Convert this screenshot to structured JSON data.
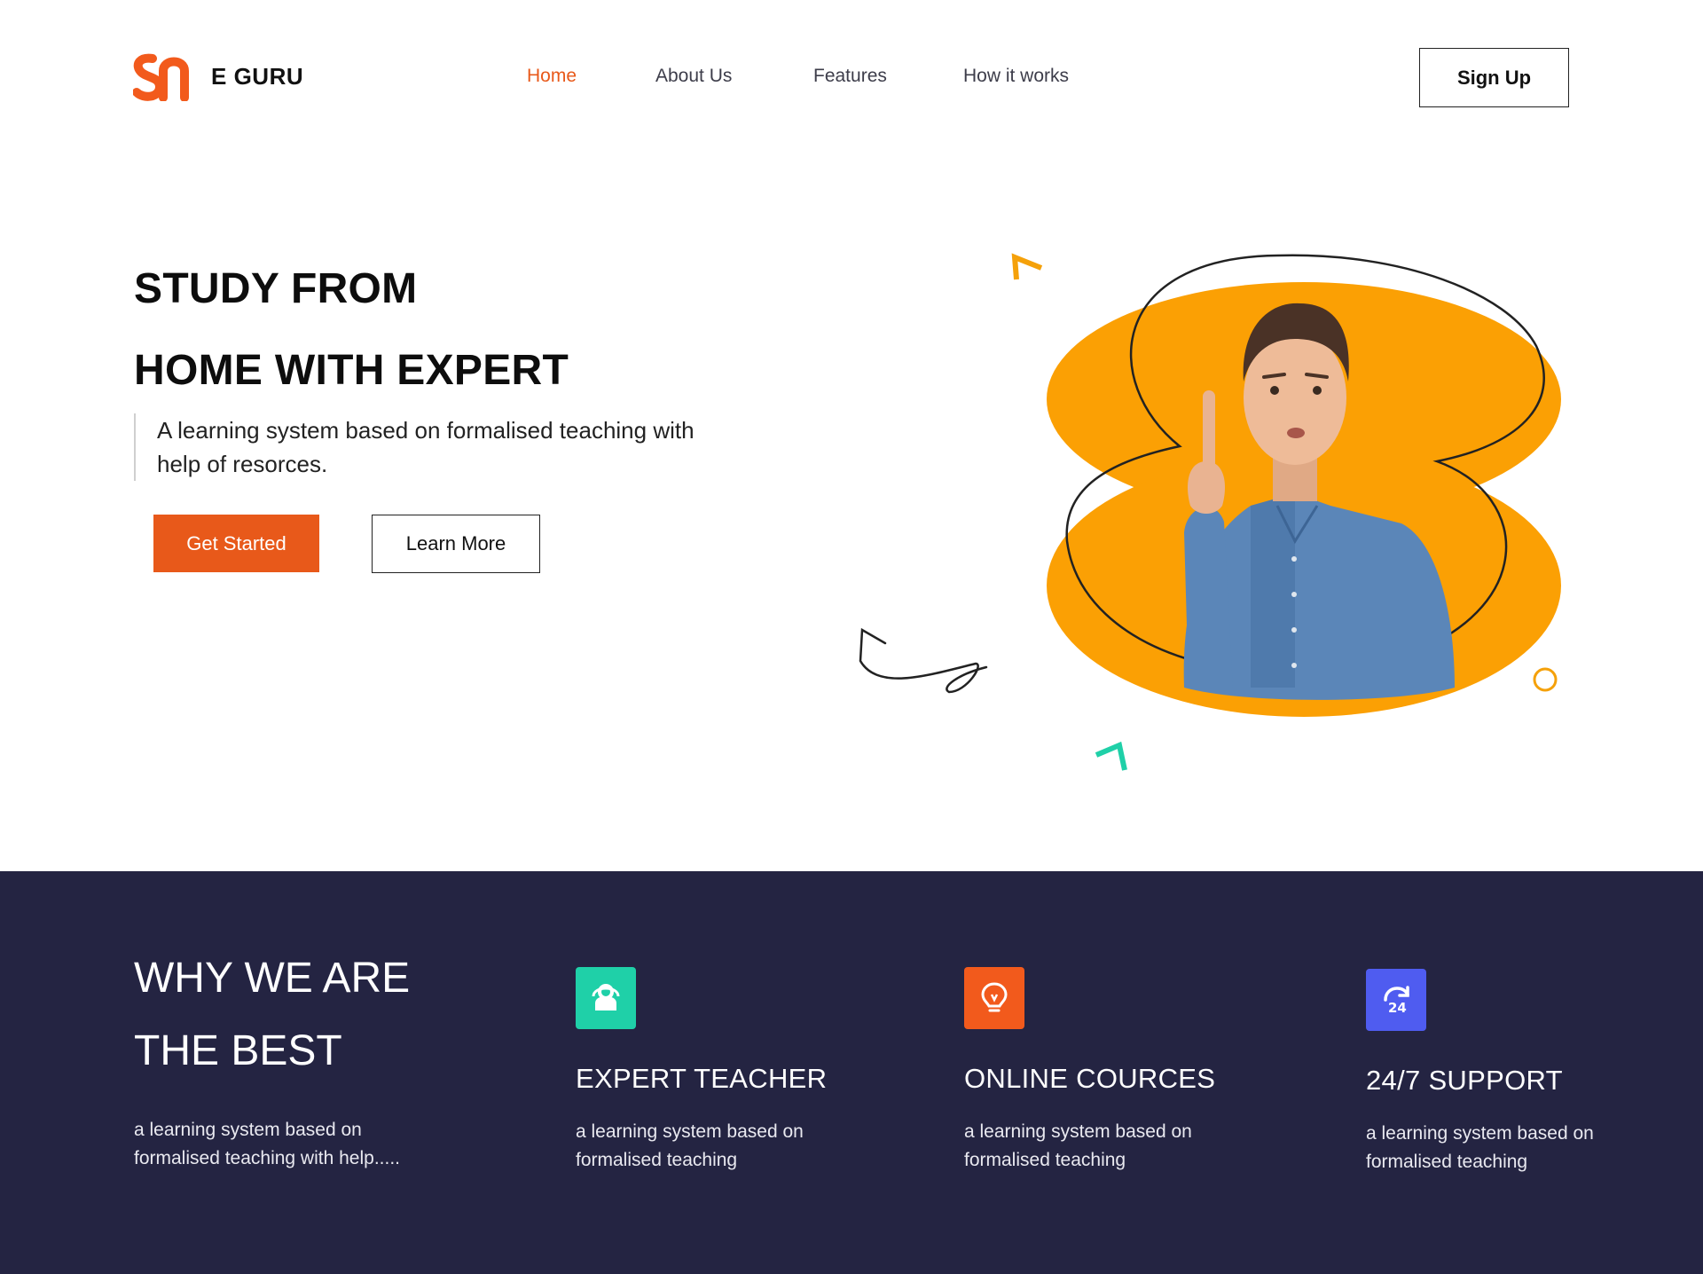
{
  "brand": {
    "name": "E GURU",
    "accent": "#e8591a"
  },
  "nav": {
    "items": [
      {
        "label": "Home",
        "active": true
      },
      {
        "label": "About Us",
        "active": false
      },
      {
        "label": "Features",
        "active": false
      },
      {
        "label": "How it works",
        "active": false
      }
    ],
    "signup_label": "Sign Up"
  },
  "hero": {
    "title_line1": "STUDY FROM",
    "title_line2": "HOME WITH EXPERT",
    "description": "A learning system based on formalised teaching with help of resorces.",
    "primary_button": "Get Started",
    "secondary_button": "Learn More",
    "illustration_icon": "student-pointing-photo"
  },
  "why": {
    "title_line1": "WHY WE ARE",
    "title_line2": "THE BEST",
    "text": "a learning system based on formalised teaching with help.....",
    "background": "#242442",
    "features": [
      {
        "icon": "teacher-icon",
        "color": "#1fd0a8",
        "title": "EXPERT TEACHER",
        "text": "a learning system based on formalised teaching"
      },
      {
        "icon": "lightbulb-icon",
        "color": "#f25a1c",
        "title": "ONLINE COURCES",
        "text": "a learning system based on formalised teaching"
      },
      {
        "icon": "support-24-icon",
        "color": "#4f5cf0",
        "title": "24/7 SUPPORT",
        "text": "a learning system based on formalised teaching"
      }
    ]
  }
}
